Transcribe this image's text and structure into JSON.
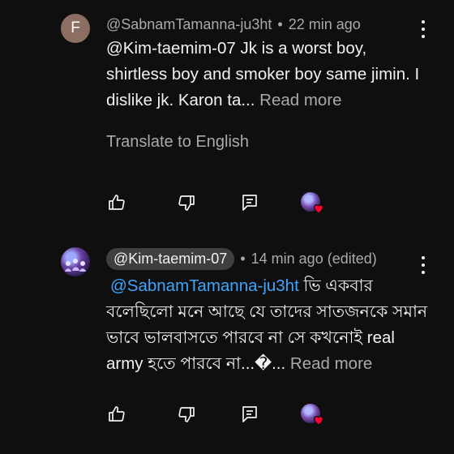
{
  "comments": [
    {
      "avatar_letter": "F",
      "author": "@SabnamTamanna-ju3ht",
      "sep": "•",
      "time": "22 min ago",
      "text": "@Kim-taemim-07  Jk is a worst boy, shirtless boy and smoker boy same jimin. I dislike jk. Karon ta...",
      "read_more": "Read more",
      "translate_label": "Translate to English"
    },
    {
      "author": "@Kim-taemim-07",
      "sep": "•",
      "time": "14 min ago (edited)",
      "mention": "@SabnamTamanna-ju3ht",
      "text": " ভি একবার বলেছিলো মনে আছে যে তাদের সাতজনকে সমান ভাবে ভালবাসতে পারবে না সে কখনোই real army হতে পারবে না...�...",
      "read_more": "Read more"
    }
  ],
  "icons": {
    "like": "thumb-up-icon",
    "dislike": "thumb-down-icon",
    "reply": "reply-icon",
    "heart": "heart-icon",
    "menu": "more-vert-icon"
  },
  "colors": {
    "background": "#0f0f0f",
    "link": "#3ea6ff",
    "secondary_text": "#aaaaaa",
    "heart": "#ff0033"
  }
}
